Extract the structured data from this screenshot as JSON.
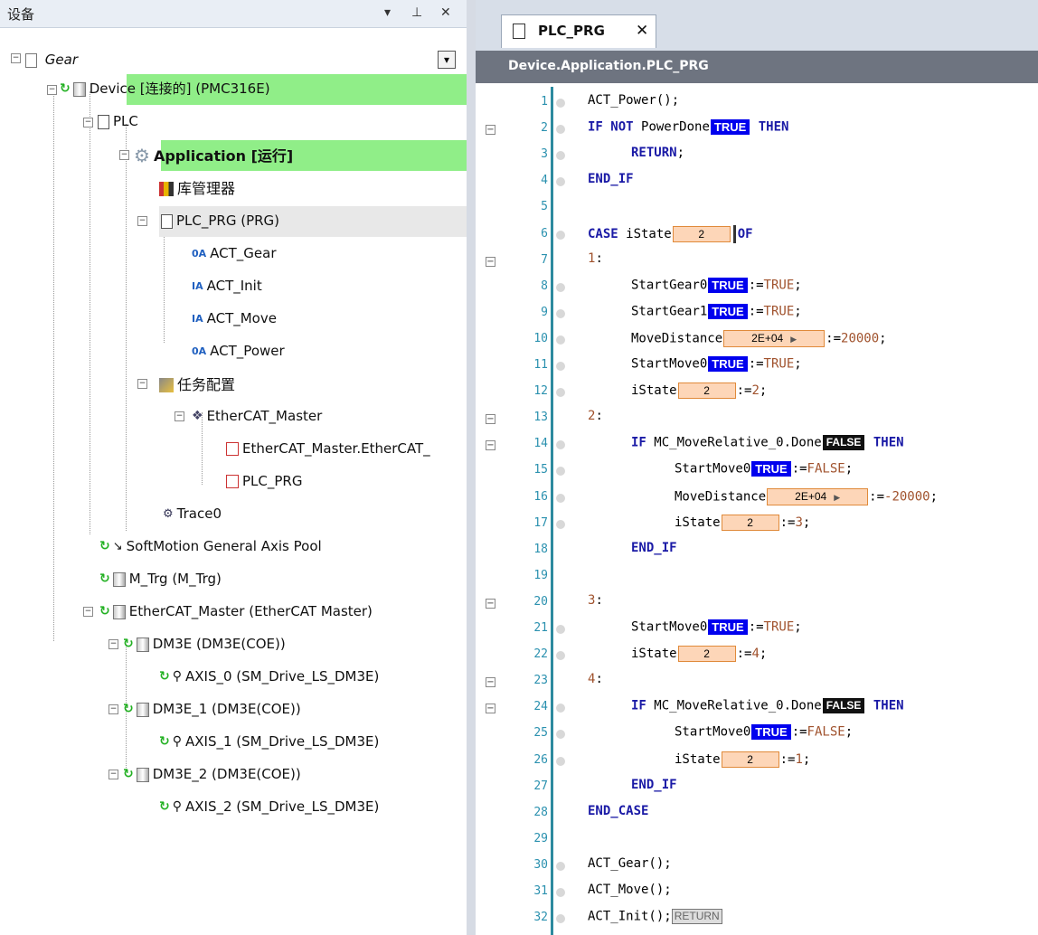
{
  "device_pane": {
    "title": "设备",
    "pin_label": "ㅁ",
    "dropdown_label": "▾",
    "close_label": "✕",
    "combo_arrow": "▾",
    "tree": {
      "gear": "Gear",
      "device": "Device [连接的] (PMC316E)",
      "plc": "PLC",
      "application": "Application [运行]",
      "library_manager": "库管理器",
      "plc_prg": "PLC_PRG (PRG)",
      "act_gear": "ACT_Gear",
      "act_init": "ACT_Init",
      "act_move": "ACT_Move",
      "act_power": "ACT_Power",
      "task_config": "任务配置",
      "ethercat_master_task": "EtherCAT_Master",
      "ethercat_master_call": "EtherCAT_Master.EtherCAT_",
      "plc_prg_call": "PLC_PRG",
      "trace": "Trace0",
      "axis_pool": "SoftMotion General Axis Pool",
      "m_trg": "M_Trg (M_Trg)",
      "ethercat_master": "EtherCAT_Master (EtherCAT Master)",
      "dm3e": "DM3E (DM3E(COE))",
      "axis0": "AXIS_0 (SM_Drive_LS_DM3E)",
      "dm3e_1": "DM3E_1 (DM3E(COE))",
      "axis1": "AXIS_1 (SM_Drive_LS_DM3E)",
      "dm3e_2": "DM3E_2 (DM3E(COE))",
      "axis2": "AXIS_2 (SM_Drive_LS_DM3E)"
    }
  },
  "editor": {
    "tab_label": "PLC_PRG",
    "tab_close": "✕",
    "breadcrumb": "Device.Application.PLC_PRG",
    "lines": [
      {
        "n": "1",
        "text": "ACT_Power();"
      },
      {
        "n": "2",
        "pre": "IF NOT PowerDone",
        "ov": "TRUE",
        "post": " THEN"
      },
      {
        "n": "3",
        "text": "RETURN;"
      },
      {
        "n": "4",
        "text": "END_IF"
      },
      {
        "n": "5",
        "text": ""
      },
      {
        "n": "6",
        "pre": "CASE iState",
        "ov": "2",
        "post": "OF"
      },
      {
        "n": "7",
        "text": "1:"
      },
      {
        "n": "8",
        "pre": "StartGear0",
        "ov": "TRUE",
        "post": ":=TRUE;"
      },
      {
        "n": "9",
        "pre": "StartGear1",
        "ov": "TRUE",
        "post": ":=TRUE;"
      },
      {
        "n": "10",
        "pre": "MoveDistance",
        "ov": "2E+04",
        "post": ":=20000;"
      },
      {
        "n": "11",
        "pre": "StartMove0",
        "ov": "TRUE",
        "post": ":=TRUE;"
      },
      {
        "n": "12",
        "pre": "iState",
        "ov": "2",
        "post": ":=2;"
      },
      {
        "n": "13",
        "text": "2:"
      },
      {
        "n": "14",
        "pre": "IF MC_MoveRelative_0.Done",
        "ov": "FALSE",
        "post": " THEN"
      },
      {
        "n": "15",
        "pre": "StartMove0",
        "ov": "TRUE",
        "post": ":=FALSE;"
      },
      {
        "n": "16",
        "pre": "MoveDistance",
        "ov": "2E+04",
        "post": ":=-20000;"
      },
      {
        "n": "17",
        "pre": "iState",
        "ov": "2",
        "post": ":=3;"
      },
      {
        "n": "18",
        "text": "END_IF"
      },
      {
        "n": "19",
        "text": ""
      },
      {
        "n": "20",
        "text": "3:"
      },
      {
        "n": "21",
        "pre": "StartMove0",
        "ov": "TRUE",
        "post": ":=TRUE;"
      },
      {
        "n": "22",
        "pre": "iState",
        "ov": "2",
        "post": ":=4;"
      },
      {
        "n": "23",
        "text": "4:"
      },
      {
        "n": "24",
        "pre": "IF MC_MoveRelative_0.Done",
        "ov": "FALSE",
        "post": " THEN"
      },
      {
        "n": "25",
        "pre": "StartMove0",
        "ov": "TRUE",
        "post": ":=FALSE;"
      },
      {
        "n": "26",
        "pre": "iState",
        "ov": "2",
        "post": ":=1;"
      },
      {
        "n": "27",
        "text": "END_IF"
      },
      {
        "n": "28",
        "text": "END_CASE"
      },
      {
        "n": "29",
        "text": ""
      },
      {
        "n": "30",
        "text": "ACT_Gear();"
      },
      {
        "n": "31",
        "text": "ACT_Move();"
      },
      {
        "n": "32",
        "pre": "ACT_Init();",
        "ov": "RETURN",
        "post": ""
      }
    ]
  },
  "colors": {
    "running_highlight": "#90ee88",
    "online_true_bg": "#0000ee",
    "online_false_bg": "#111111",
    "online_value_bg": "#fdd6b8",
    "line_number": "#2b91af"
  }
}
